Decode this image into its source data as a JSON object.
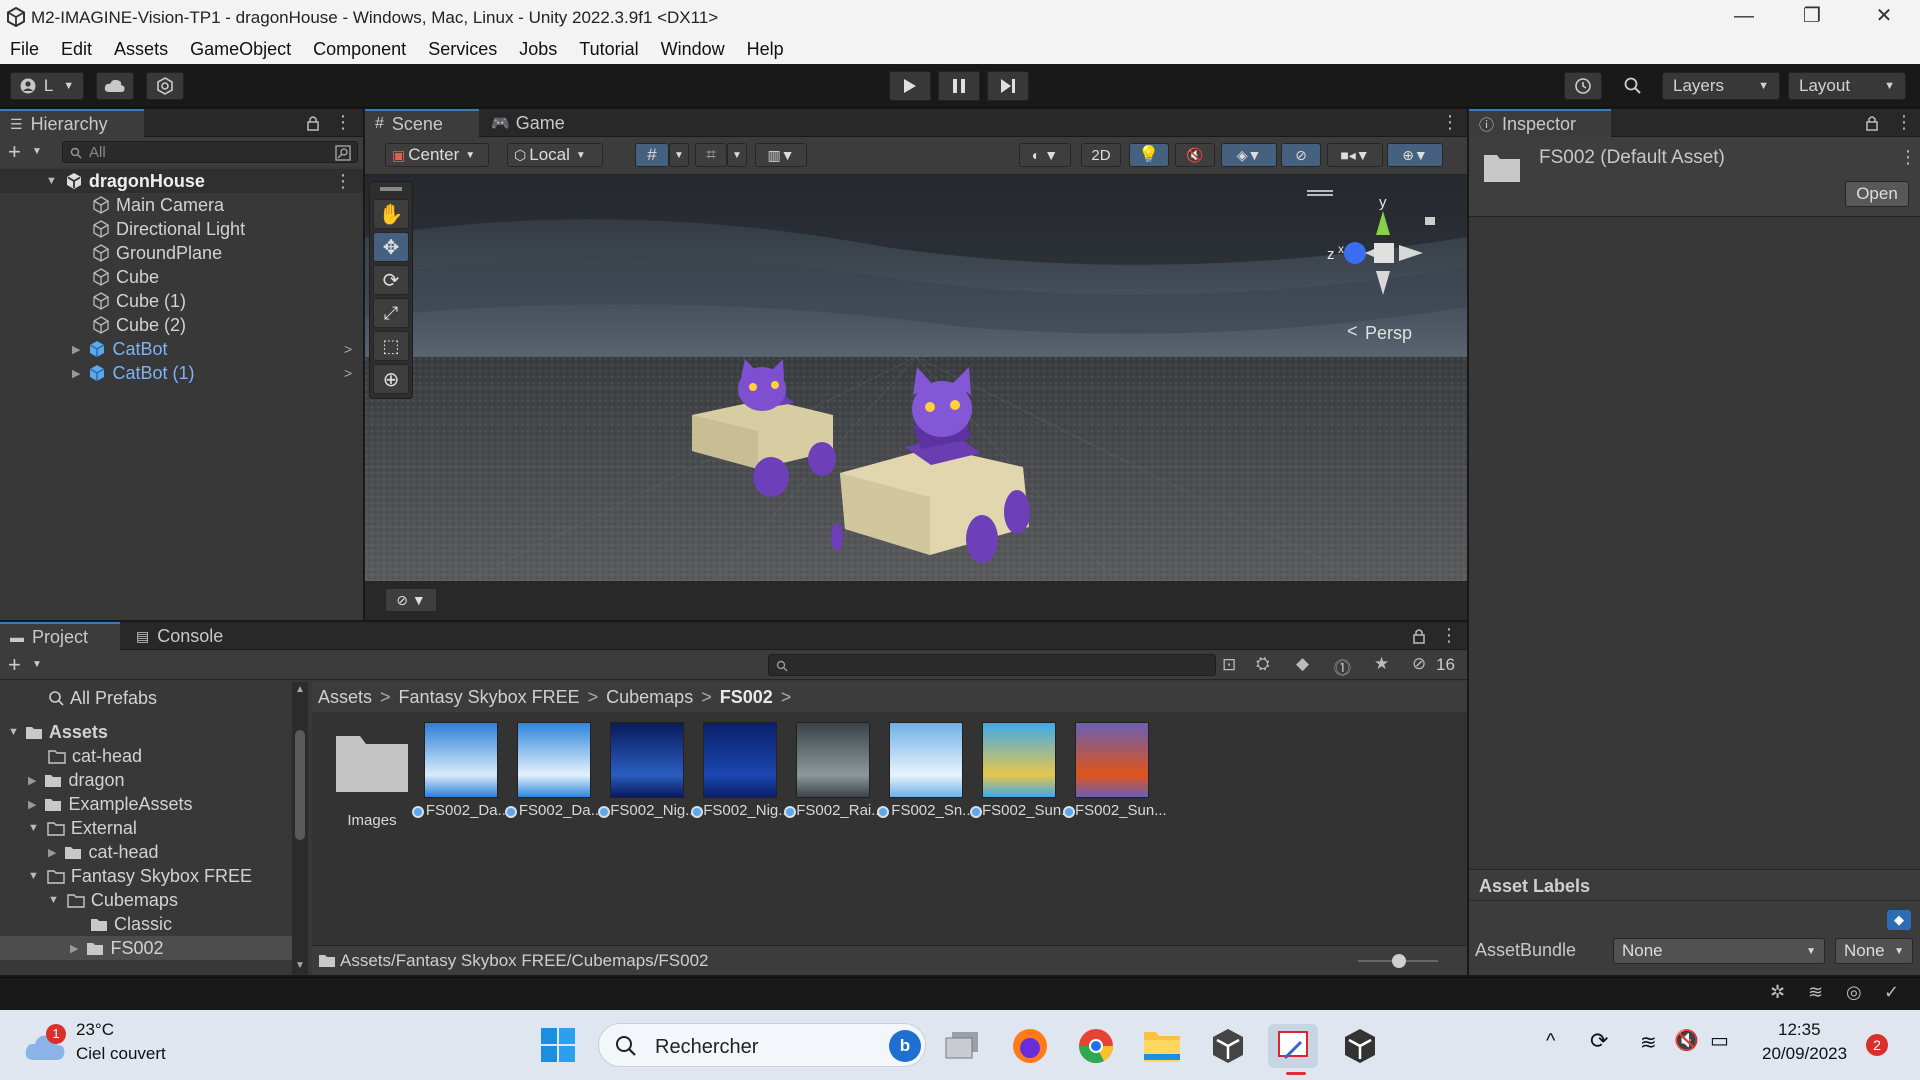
{
  "window": {
    "title": "M2-IMAGINE-Vision-TP1 - dragonHouse - Windows, Mac, Linux - Unity 2022.3.9f1 <DX11>",
    "minimize": "—",
    "restore": "❐",
    "close": "✕"
  },
  "menu": [
    "File",
    "Edit",
    "Assets",
    "GameObject",
    "Component",
    "Services",
    "Jobs",
    "Tutorial",
    "Window",
    "Help"
  ],
  "toolbar": {
    "account_label": "L",
    "layers_label": "Layers",
    "layout_label": "Layout"
  },
  "hierarchy": {
    "tab": "Hierarchy",
    "search_placeholder": "All",
    "scene_name": "dragonHouse",
    "items": [
      {
        "label": "Main Camera"
      },
      {
        "label": "Directional Light"
      },
      {
        "label": "GroundPlane"
      },
      {
        "label": "Cube"
      },
      {
        "label": "Cube (1)"
      },
      {
        "label": "Cube (2)"
      },
      {
        "label": "CatBot"
      },
      {
        "label": "CatBot (1)"
      }
    ]
  },
  "scene": {
    "tab_scene": "Scene",
    "tab_game": "Game",
    "pivot": "Center",
    "space": "Local",
    "mode_2d": "2D",
    "persp": "Persp",
    "gizmo_y": "y",
    "gizmo_z": "z",
    "gizmo_x": "x"
  },
  "inspector": {
    "tab": "Inspector",
    "asset_name": "FS002 (Default Asset)",
    "open_button": "Open",
    "asset_labels": "Asset Labels",
    "asset_bundle_label": "AssetBundle",
    "asset_bundle_value": "None",
    "asset_bundle_variant": "None"
  },
  "project": {
    "tab_project": "Project",
    "tab_console": "Console",
    "hidden_count": "16",
    "all_prefabs": "All Prefabs",
    "breadcrumb": [
      "Assets",
      "Fantasy Skybox FREE",
      "Cubemaps",
      "FS002"
    ],
    "tree": [
      {
        "label": "Assets",
        "bold": true
      },
      {
        "label": "cat-head"
      },
      {
        "label": "dragon"
      },
      {
        "label": "ExampleAssets"
      },
      {
        "label": "External"
      },
      {
        "label": "cat-head"
      },
      {
        "label": "Fantasy Skybox FREE"
      },
      {
        "label": "Cubemaps"
      },
      {
        "label": "Classic"
      },
      {
        "label": "FS002"
      }
    ],
    "folder_label": "Images",
    "assets": [
      {
        "label": "FS002_Da...",
        "c1": "#2e7fd8",
        "c2": "#d9ecfb"
      },
      {
        "label": "FS002_Da...",
        "c1": "#2f86db",
        "c2": "#e4f2fc"
      },
      {
        "label": "FS002_Nig...",
        "c1": "#091a5c",
        "c2": "#2a5dc0"
      },
      {
        "label": "FS002_Nig...",
        "c1": "#0a1f6a",
        "c2": "#1b47b0"
      },
      {
        "label": "FS002_Rai...",
        "c1": "#3a4348",
        "c2": "#8d989d"
      },
      {
        "label": "FS002_Sn...",
        "c1": "#6fb0e6",
        "c2": "#e9f4fb"
      },
      {
        "label": "FS002_Sun...",
        "c1": "#3fa9e9",
        "c2": "#e6c64c"
      },
      {
        "label": "FS002_Sun...",
        "c1": "#6a5fb3",
        "c2": "#e0541b"
      }
    ],
    "path": "Assets/Fantasy Skybox FREE/Cubemaps/FS002"
  },
  "taskbar": {
    "weather_temp": "23°C",
    "weather_desc": "Ciel couvert",
    "weather_badge": "1",
    "search_placeholder": "Rechercher",
    "time": "12:35",
    "date": "20/09/2023",
    "notif_count": "2"
  }
}
